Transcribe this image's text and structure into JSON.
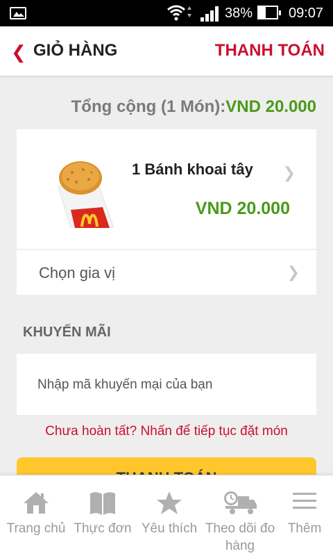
{
  "status_bar": {
    "battery": "38%",
    "time": "09:07"
  },
  "header": {
    "title": "GIỎ HÀNG",
    "checkout": "THANH TOÁN",
    "back_icon": "chevron-left-icon"
  },
  "cart": {
    "total_label": "Tổng cộng (1 Món):",
    "total_amount": "VND 20.000",
    "item": {
      "name": "1 Bánh khoai tây",
      "price": "VND 20.000"
    },
    "spice_label": "Chọn gia vị"
  },
  "promo": {
    "heading": "KHUYẾN MÃI",
    "placeholder": "Nhập mã khuyến mại của bạn"
  },
  "continue_link": "Chưa hoàn tất? Nhấn để tiếp tục đặt món",
  "checkout_button": "THANH TOÁN",
  "bottom_nav": [
    {
      "label": "Trang chủ",
      "icon": "home-icon"
    },
    {
      "label": "Thực đơn",
      "icon": "menu-book-icon"
    },
    {
      "label": "Yêu thích",
      "icon": "star-icon"
    },
    {
      "label": "Theo dõi đo hàng",
      "icon": "delivery-truck-icon"
    },
    {
      "label": "Thêm",
      "icon": "hamburger-icon"
    }
  ],
  "colors": {
    "brand_red": "#c8102e",
    "price_green": "#4a9a1a",
    "button_yellow": "#ffc72c"
  }
}
